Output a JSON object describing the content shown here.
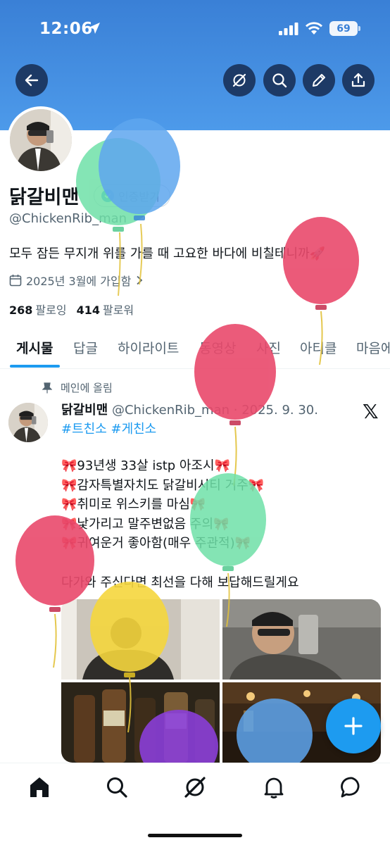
{
  "status_bar": {
    "time": "12:06",
    "battery": "69"
  },
  "top_actions": {
    "back_icon": "arrow-left-icon",
    "grok_icon": "grok-icon",
    "search_icon": "search-icon",
    "edit_icon": "pencil-icon",
    "share_icon": "share-icon"
  },
  "profile": {
    "display_name": "닭갈비맨",
    "verify_label": "인증받기",
    "handle": "@ChickenRib_man",
    "bio": "모두 잠든 무지개 위를 가를 때 고요한 바다에 비칠테니까🚀",
    "joined": "2025년 3월에 가입함",
    "following_count": "268",
    "following_label": "팔로잉",
    "followers_count": "414",
    "followers_label": "팔로워"
  },
  "tabs": [
    "게시물",
    "답글",
    "하이라이트",
    "동영상",
    "사진",
    "아티클",
    "마음에"
  ],
  "post": {
    "pinned_label": "메인에 올림",
    "author": "닭갈비맨",
    "meta": "@ChickenRib_man · 2025. 9. 30.",
    "hashtags": "#트친소 #게친소",
    "lines": [
      "🎀93년생 33살 istp 아조시🎀",
      "🎀감자특별자치도 닭갈비시티 거주🎀",
      "🎀취미로 위스키를 마심🎀",
      "🎀낯가리고 말주변없음 주의🎀",
      "🎀귀여운거 좋아함(매우 주관적)🎀"
    ],
    "closing": "다가와 주신다면 최선을 다해 보답해드릴게요"
  },
  "colors": {
    "banner": "#3a80d6",
    "accent": "#1d9bf0",
    "text": "#0f1419",
    "muted": "#536471"
  }
}
